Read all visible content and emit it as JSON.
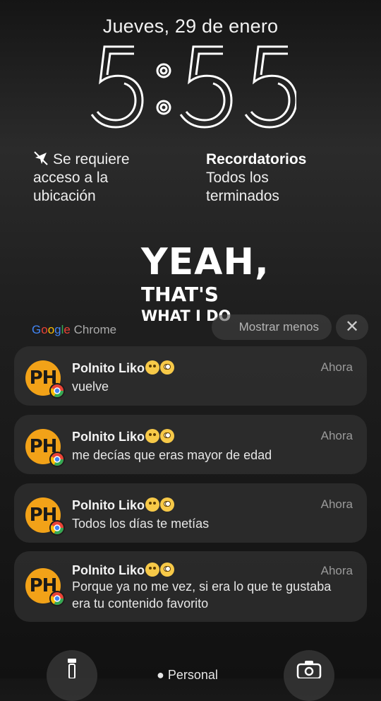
{
  "lockscreen": {
    "date": "Jueves, 29 de enero",
    "time": "5:55"
  },
  "widgets": {
    "location": {
      "icon": "location-off-icon",
      "text_line1": "Se requiere",
      "text_line2": "acceso a la",
      "text_line3": "ubicación"
    },
    "reminders": {
      "title": "Recordatorios",
      "text_line1": "Todos los",
      "text_line2": "terminados"
    }
  },
  "overlay": {
    "line1": "YEAH,",
    "line2": "THAT'S",
    "line3": "WHAT I DO"
  },
  "notification_group": {
    "app_name_parts": [
      "G",
      "o",
      "o",
      "g",
      "l",
      "e"
    ],
    "app_name_suffix": " Chrome",
    "show_less_label": "Mostrar menos",
    "close_icon": "close-icon"
  },
  "notifications": [
    {
      "avatar_text": "PH",
      "sender": "Polnito Liko",
      "time": "Ahora",
      "message": "vuelve"
    },
    {
      "avatar_text": "PH",
      "sender": "Polnito Liko",
      "time": "Ahora",
      "message": "me decías que eras mayor de edad"
    },
    {
      "avatar_text": "PH",
      "sender": "Polnito Liko",
      "time": "Ahora",
      "message": "Todos los días te metías"
    },
    {
      "avatar_text": "PH",
      "sender": "Polnito Liko",
      "time": "Ahora",
      "message": "Porque ya no me vez, si era lo que te gustaba era tu contenido favorito"
    }
  ],
  "dock": {
    "left_icon": "flashlight-icon",
    "center_label": "Personal",
    "right_icon": "camera-icon"
  }
}
